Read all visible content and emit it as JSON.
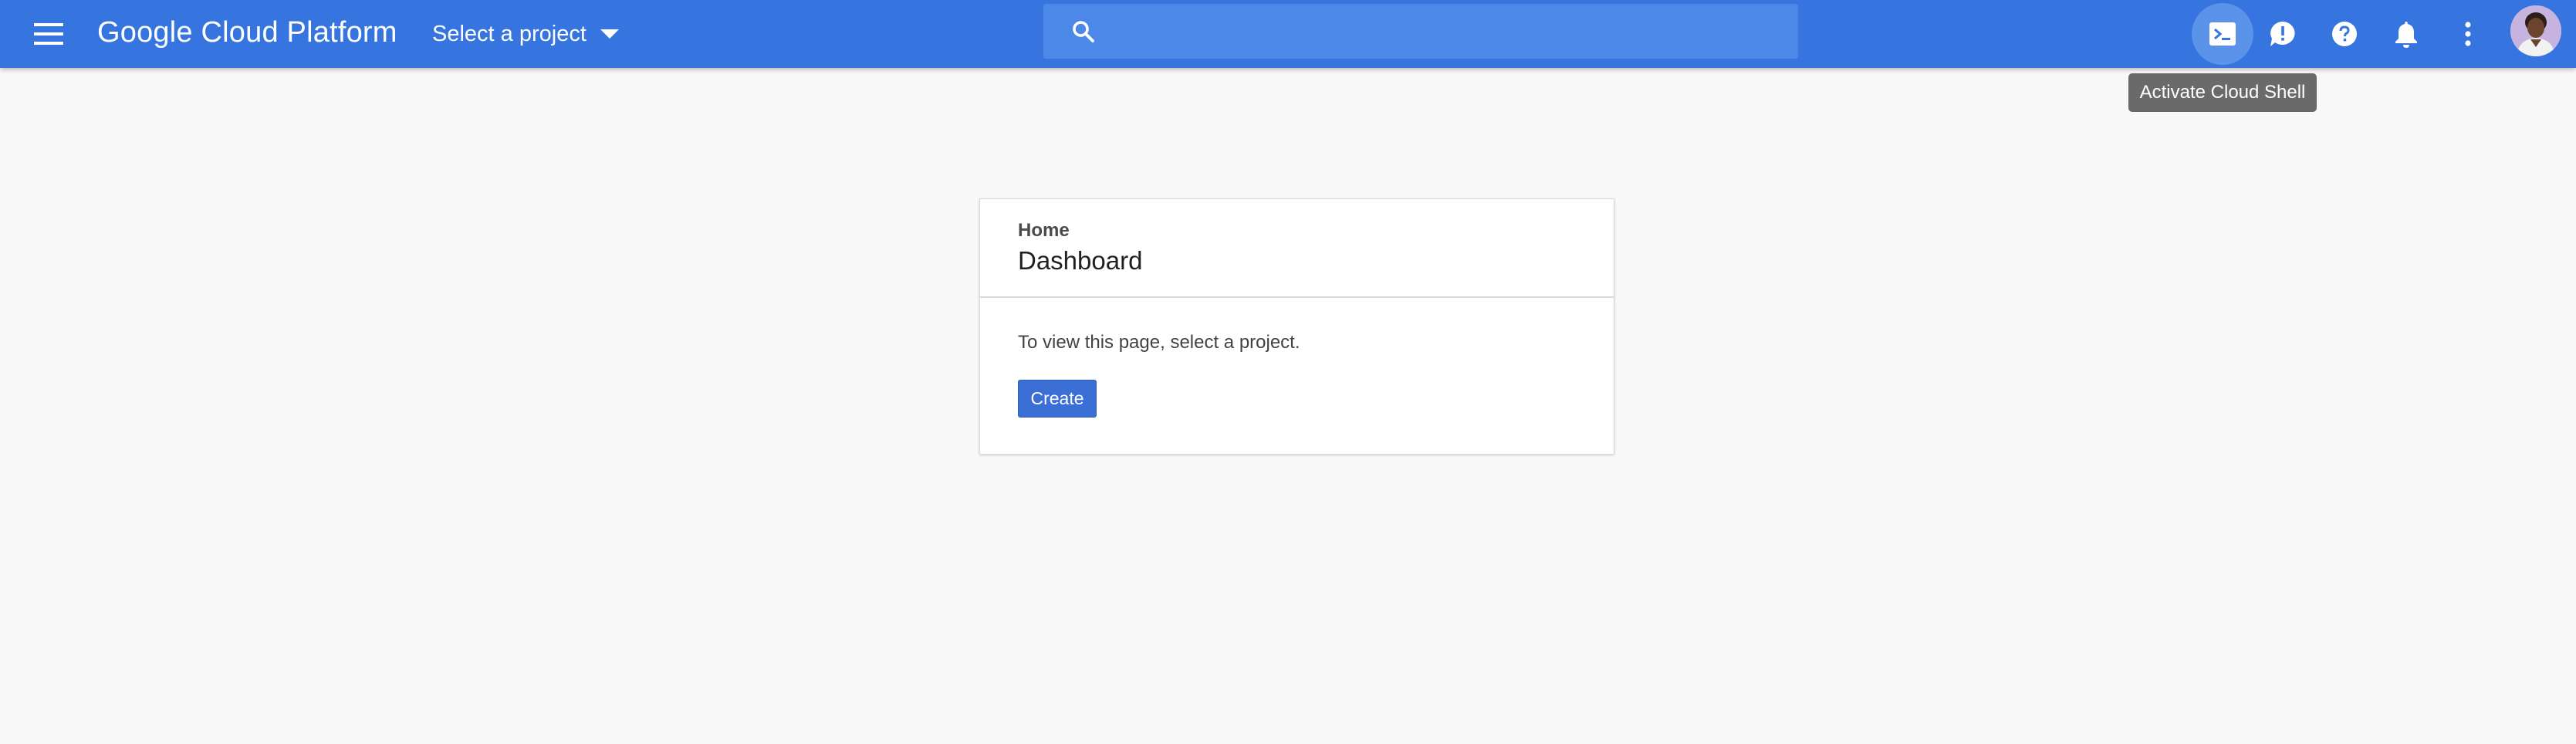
{
  "header": {
    "app_title": "Google Cloud Platform",
    "project_selector_label": "Select a project",
    "search": {
      "placeholder": "",
      "value": ""
    },
    "icons": [
      {
        "name": "menu-icon"
      },
      {
        "name": "caret-down-icon"
      },
      {
        "name": "search-icon"
      },
      {
        "name": "cloud-shell-icon",
        "state": "hovered"
      },
      {
        "name": "feedback-icon"
      },
      {
        "name": "help-icon"
      },
      {
        "name": "notifications-icon"
      },
      {
        "name": "more-vert-icon"
      }
    ],
    "colors": {
      "bar": "#3674e0",
      "search": "#4c88e8"
    }
  },
  "tooltip": {
    "text": "Activate Cloud Shell"
  },
  "card": {
    "breadcrumb": "Home",
    "title": "Dashboard",
    "message": "To view this page, select a project.",
    "create_label": "Create",
    "colors": {
      "button": "#3b6fd6"
    }
  }
}
